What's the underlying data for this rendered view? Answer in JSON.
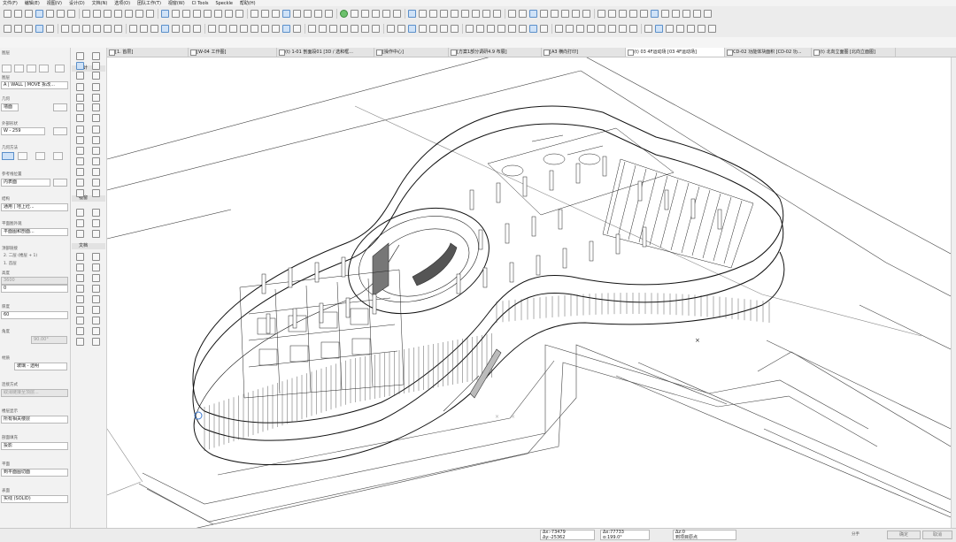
{
  "menu": [
    "文件(F)",
    "编辑(E)",
    "视图(V)",
    "设计(D)",
    "文档(N)",
    "选项(O)",
    "团队工作(T)",
    "视窗(W)",
    "CI Tools",
    "Speckle",
    "帮助(H)"
  ],
  "tabs": [
    {
      "label": "[1. 首层]"
    },
    {
      "label": "[W-04 工作图]"
    },
    {
      "label": "(t) 1-01 剖面段01 [3D / 选和框..."
    },
    {
      "label": "[操作中心]"
    },
    {
      "label": "[方案1部分调研4.9 布展]"
    },
    {
      "label": "[A3 横向打印]"
    },
    {
      "label": "(t) 03 4F运动场 [03 4F运动场]"
    },
    {
      "label": "CD-02 功能体块面积 [CD-02 功..."
    },
    {
      "label": "(t) 北向立面图 [北向立面图]"
    }
  ],
  "active_tab": 6,
  "info_panel": {
    "header": "设计",
    "fields": [
      {
        "label": "图层",
        "value": ""
      },
      {
        "label": "图层",
        "value": "A | WALL | MOVE 拆改..."
      },
      {
        "label": "几何",
        "value": "墙面"
      },
      {
        "label": "",
        "value": "W - 259"
      },
      {
        "label": "几何方法",
        "value": ""
      },
      {
        "label": "参考线位置",
        "value": "内表面"
      },
      {
        "label": "",
        "value": "通用 | 地上砼..."
      },
      {
        "label": "平面图外观",
        "value": "平面图和剖面..."
      },
      {
        "label": "楼层",
        "value": "2. 二层 (楼层 + 1)"
      },
      {
        "label": "",
        "value": "1. 首层"
      },
      {
        "label": "高度",
        "value": "3600"
      },
      {
        "label": "",
        "value": "0"
      },
      {
        "label": "厚度",
        "value": "60"
      },
      {
        "label": "角度",
        "value": "90.00°"
      },
      {
        "label": "材质",
        "value": "玻璃 - 透明"
      },
      {
        "label": "链接至楼层",
        "value": "取消链接至顶层..."
      },
      {
        "label": "相关到楼层",
        "value": "所有相关楼层"
      },
      {
        "label": "剖面图表示",
        "value": "投影"
      },
      {
        "label": "平面显示",
        "value": "到平面图切面"
      },
      {
        "label": "表面填充",
        "value": "实线 (SOLID)"
      }
    ]
  },
  "toolbox": {
    "sections": [
      "设计",
      "视窗",
      "文档"
    ]
  },
  "statusbar": {
    "x_label": "Δx:",
    "x_value": "-73479",
    "y_label": "Δy:",
    "y_value": "-25362",
    "dx_label": "Δx:",
    "dx_value": "77733",
    "a_label": "α:",
    "a_value": "199.0°",
    "z_label": "Δz:",
    "z_value": "0",
    "ref_label": "到项目原点",
    "ok_label": "确定",
    "cancel_label": "取消",
    "zoom": "分手"
  },
  "colors": {
    "accent": "#3d7bd2",
    "canvas": "#ffffff",
    "chrome": "#ececec"
  }
}
